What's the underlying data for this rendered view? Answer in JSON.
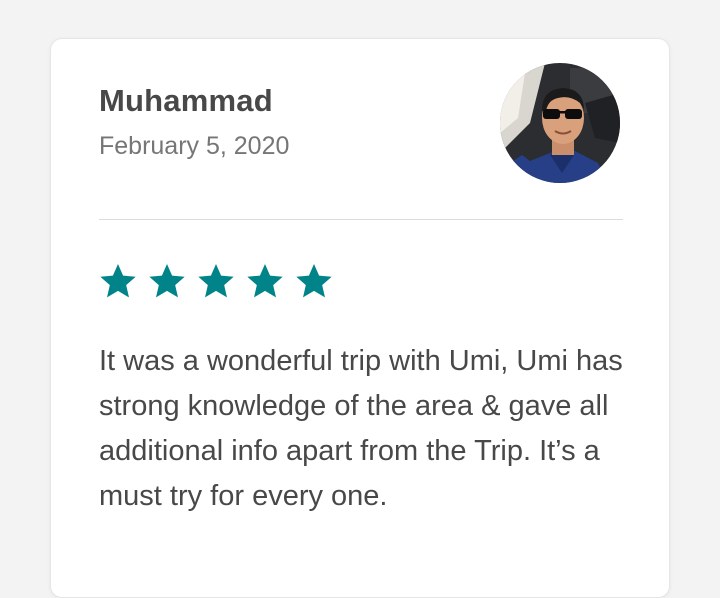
{
  "review": {
    "reviewer_name": "Muhammad",
    "date": "February 5, 2020",
    "rating": 5,
    "max_rating": 5,
    "star_color": "#008489",
    "text": "It was a wonderful trip with Umi, Umi has strong knowledge of the area & gave all additional info apart from the Trip. It’s a must try for every one."
  }
}
